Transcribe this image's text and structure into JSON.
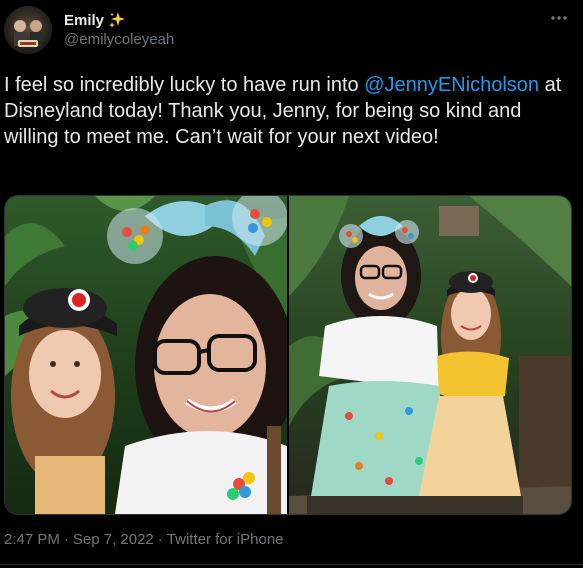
{
  "tweet": {
    "author": {
      "display_name": "Emily",
      "emoji": "✨",
      "handle": "@emilycoleyeah"
    },
    "text": {
      "before": "I feel so incredibly lucky to have run into ",
      "mention": "@JennyENicholson",
      "after": " at Disneyland today! Thank you, Jenny, for being so kind and willing to meet me. Can’t wait for your next video!"
    },
    "media": [
      {
        "kind": "photo",
        "description_icon": "selfie-photo"
      },
      {
        "kind": "photo",
        "description_icon": "full-body-photo"
      }
    ],
    "meta": {
      "time": "2:47 PM",
      "sep1": "·",
      "date": "Sep 7, 2022",
      "sep2": "·",
      "source": "Twitter for iPhone"
    }
  },
  "colors": {
    "background": "#000000",
    "text": "#e7e9ea",
    "secondary": "#71767b",
    "link": "#1d9bf0",
    "border": "#2f3336"
  }
}
